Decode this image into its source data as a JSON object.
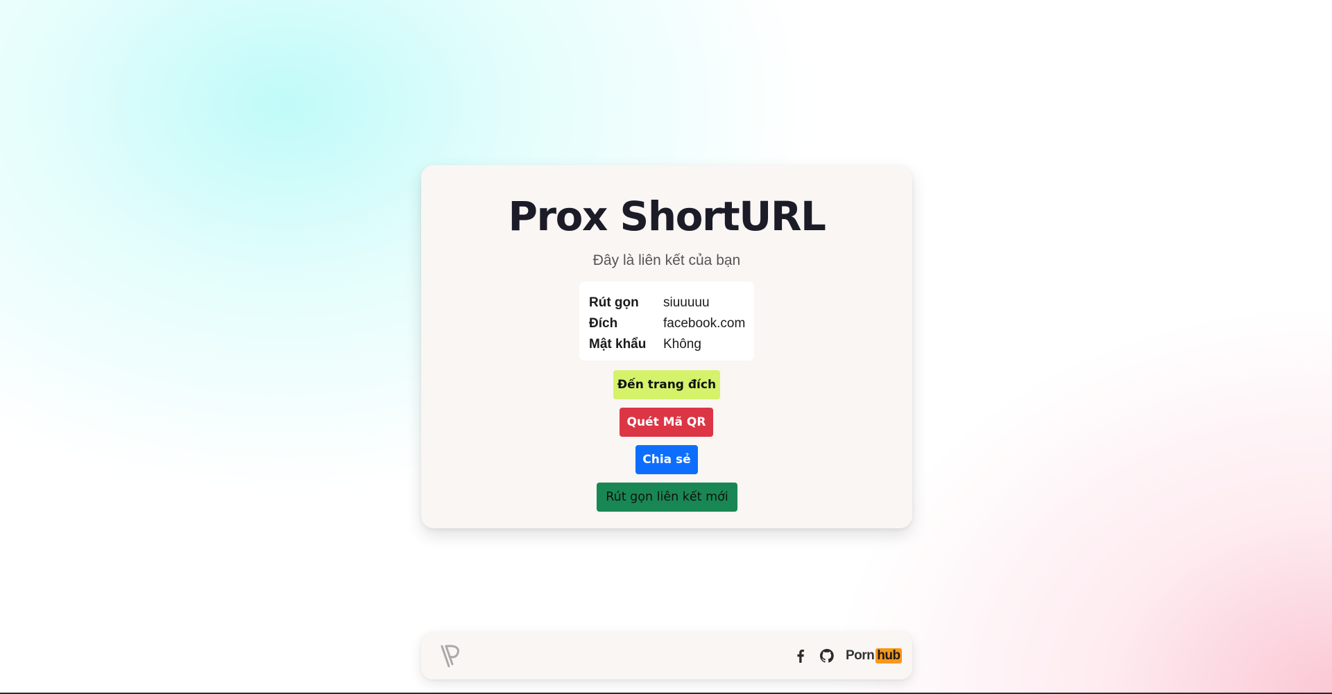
{
  "card": {
    "title": "Prox ShortURL",
    "subtitle": "Đây là liên kết của bạn",
    "info": [
      {
        "key": "Rút gọn",
        "value": "siuuuuu"
      },
      {
        "key": "Đích",
        "value": "facebook.com"
      },
      {
        "key": "Mật khẩu",
        "value": "Không"
      }
    ],
    "buttons": {
      "goto_label": "Đến trang đích",
      "qr_label": "Quét Mã QR",
      "share_label": "Chia sẻ",
      "new_label": "Rút gọn liên kết mới"
    }
  },
  "footer": {
    "logo_icon": "prox-logo-icon",
    "links": [
      {
        "icon": "facebook-icon"
      },
      {
        "icon": "github-icon"
      },
      {
        "text_part1": "Porn",
        "text_part2": "hub"
      }
    ]
  },
  "colors": {
    "goto_button": "#d5f26a",
    "qr_button": "#dc3545",
    "share_button": "#0d6efd",
    "new_button": "#198754",
    "hub_badge": "#f7971d"
  }
}
